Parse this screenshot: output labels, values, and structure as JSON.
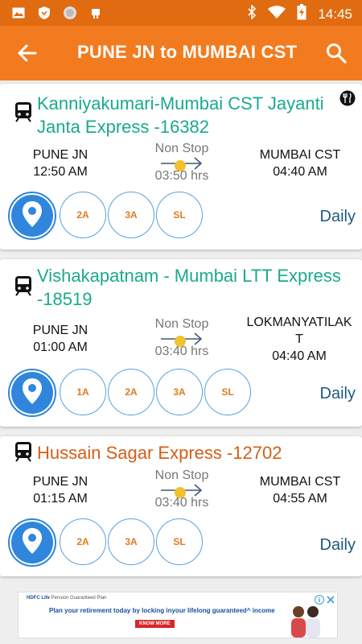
{
  "status_bar": {
    "time": "14:45",
    "left_icons": [
      "image-icon",
      "shield-icon",
      "circle-icon",
      "android-icon"
    ],
    "right_icons": [
      "bluetooth-icon",
      "wifi-icon",
      "battery-icon"
    ]
  },
  "app_bar": {
    "title": "PUNE JN to MUMBAI CST",
    "back_icon": "arrow-back-icon",
    "search_icon": "search-icon"
  },
  "trains": [
    {
      "name": "Kanniyakumari-Mumbai CST Jayanti Janta Express -16382",
      "name_color": "#1aaa8c",
      "has_food": true,
      "from_station": "PUNE JN",
      "departure": "12:50 AM",
      "stop_info": "Non Stop",
      "duration": "03:50 hrs",
      "to_station": "MUMBAI CST",
      "arrival": "04:40 AM",
      "classes": [
        "2A",
        "3A",
        "SL"
      ],
      "frequency": "Daily"
    },
    {
      "name": "Vishakapatnam - Mumbai LTT Express -18519",
      "name_color": "#1aaa8c",
      "has_food": false,
      "from_station": "PUNE JN",
      "departure": "01:00 AM",
      "stop_info": "Non Stop",
      "duration": "03:40 hrs",
      "to_station": "LOKMANYATILAK T",
      "to_station_line1": "LOKMANYATILAK",
      "to_station_line2": "T",
      "arrival": "04:40 AM",
      "classes": [
        "1A",
        "2A",
        "3A",
        "SL"
      ],
      "frequency": "Daily"
    },
    {
      "name": "Hussain Sagar Express -12702",
      "name_color": "#d45f16",
      "has_food": false,
      "from_station": "PUNE JN",
      "departure": "01:15 AM",
      "stop_info": "Non Stop",
      "duration": "03:40 hrs",
      "to_station": "MUMBAI CST",
      "arrival": "04:55 AM",
      "classes": [
        "2A",
        "3A",
        "SL"
      ],
      "frequency": "Daily"
    }
  ],
  "ad": {
    "brand": "HDFC Life",
    "brand_sub": "Pension Guaranteed Plan",
    "headline": "Plan your retirement today by locking inyour lifelong guaranteed^ income",
    "cta": "KNOW MORE"
  }
}
